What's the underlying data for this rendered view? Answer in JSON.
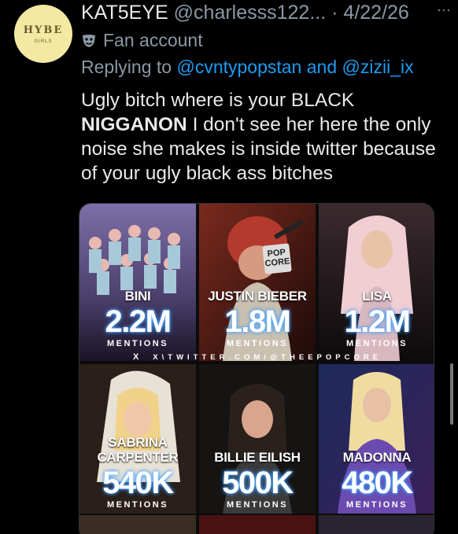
{
  "avatar": {
    "line1": "HYBE",
    "line2": "GIRLS"
  },
  "tweet": {
    "display_name": "KAT5EYE",
    "handle": "@charlesss122...",
    "separator": "·",
    "date": "4/22/26",
    "more_glyph": "···",
    "label": "Fan account",
    "replying_prefix": "Replying to",
    "mention_1": "@cvntypopstan",
    "and_word": "and",
    "mention_2": "@zizii_ix",
    "text_part1": "Ugly bitch where is your BLACK",
    "text_bold": "NIGGANON",
    "text_part2": "I don't see her here the only noise she makes is inside twitter because of your ugly black ass bitches"
  },
  "media": {
    "popcore_text": "POP CORE",
    "source_x": "X",
    "source_text": "X\\TWITTER.COM/@THEEPOPCORE",
    "row1": [
      {
        "name": "BINI",
        "count": "2.2M",
        "mentions": "MENTIONS"
      },
      {
        "name": "JUSTIN BIEBER",
        "count": "1.8M",
        "mentions": "MENTIONS"
      },
      {
        "name": "LISA",
        "count": "1.2M",
        "mentions": "MENTIONS"
      }
    ],
    "row2": [
      {
        "name_line1": "SABRINA",
        "name_line2": "CARPENTER",
        "count": "540K",
        "mentions": "MENTIONS"
      },
      {
        "name": "BILLIE EILISH",
        "count": "500K",
        "mentions": "MENTIONS"
      },
      {
        "name": "MADONNA",
        "count": "480K",
        "mentions": "MENTIONS"
      }
    ]
  },
  "colors": {
    "background": "#000000",
    "text": "#e7e9ea",
    "secondary": "#8b98a5",
    "link": "#1d9bf0",
    "count_glow": "#2a8cff"
  }
}
